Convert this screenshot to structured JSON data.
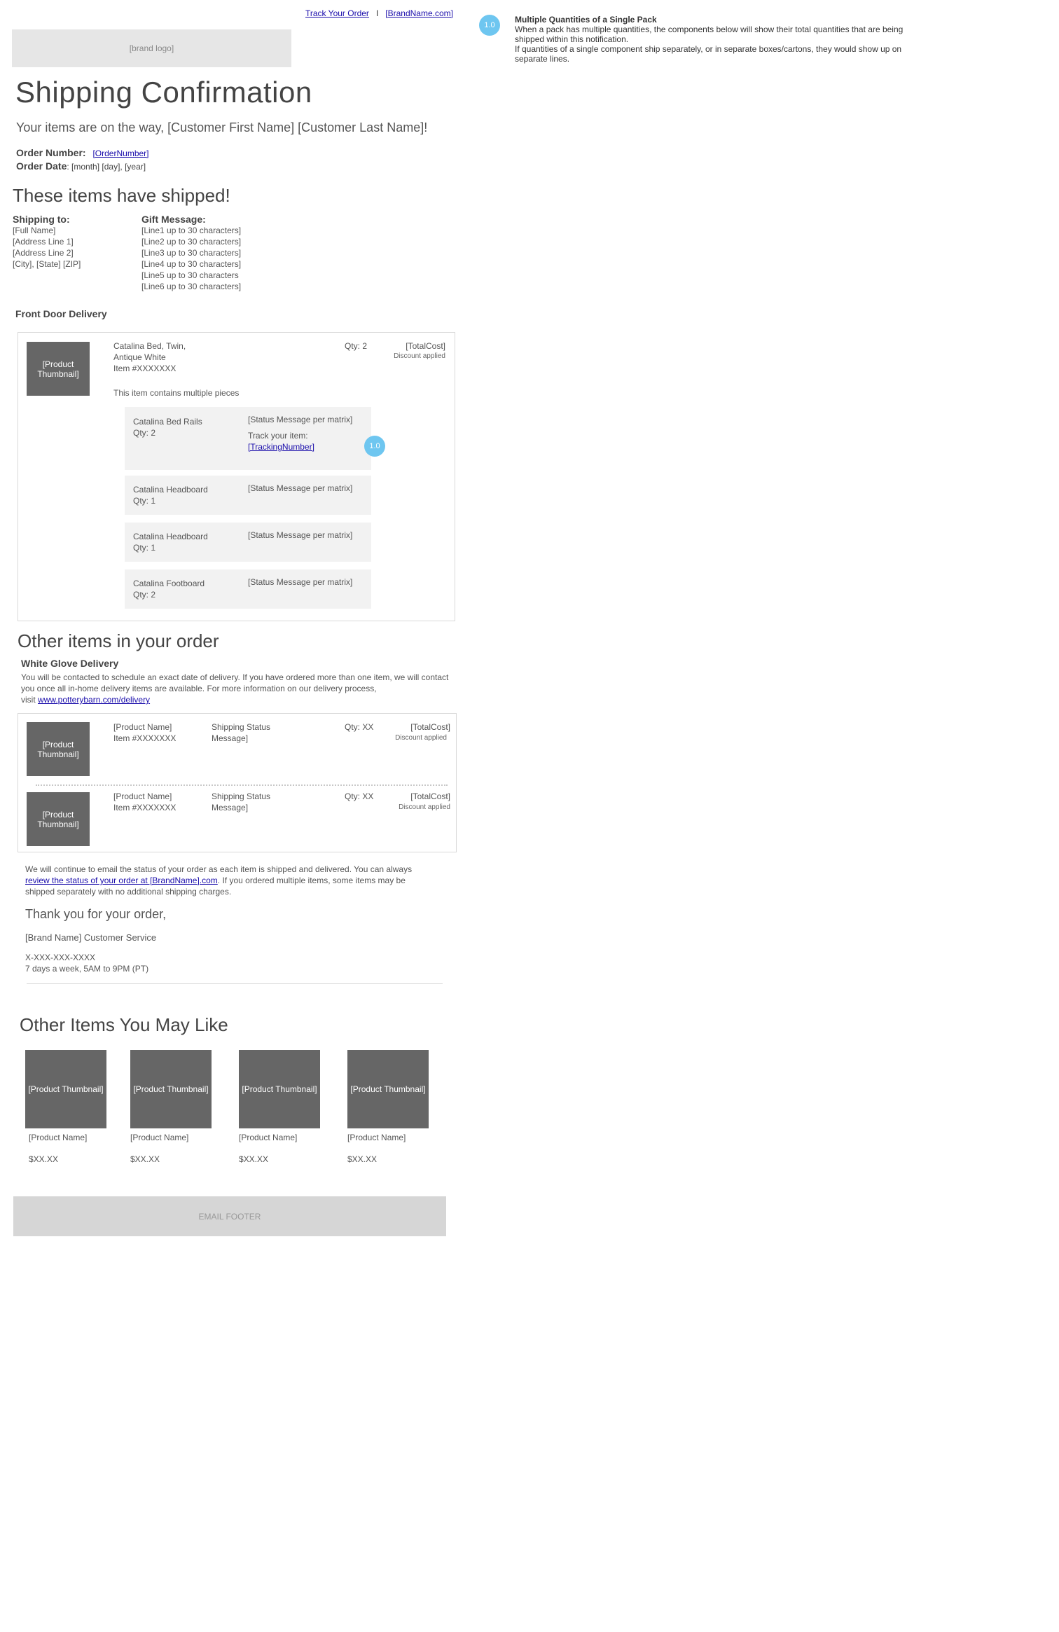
{
  "header": {
    "track_link": "Track Your Order",
    "separator": "I",
    "brand_link": "[BrandName.com]",
    "logo": "[brand logo]"
  },
  "title": "Shipping Confirmation",
  "greeting": "Your items are on the way, [Customer First Name] [Customer Last Name]!",
  "order": {
    "number_label": "Order Number:",
    "number_value": "[OrderNumber]",
    "date_label": "Order Date",
    "date_value": ": [month] [day], [year]"
  },
  "shipped": {
    "heading": "These items have shipped!",
    "shipping_label": "Shipping to:",
    "address": [
      "[Full Name]",
      "[Address Line 1]",
      "[Address Line 2]",
      "[City], [State] [ZIP]"
    ],
    "gift_label": "Gift Message:",
    "gift_lines": [
      "[Line1 up to 30 characters]",
      "[Line2 up to 30 characters]",
      "[Line3 up to 30 characters]",
      "[Line4 up to 30 characters]",
      "[Line5 up to 30 characters",
      "[Line6 up to 30 characters]"
    ],
    "delivery_type": "Front Door Delivery",
    "item": {
      "thumb": "[Product Thumbnail]",
      "name_line1": "Catalina Bed, Twin,",
      "name_line2": "Antique White",
      "sku": "Item #XXXXXXX",
      "qty": "Qty: 2",
      "total": "[TotalCost]",
      "discount": "Discount applied",
      "multi_note": "This item contains multiple pieces"
    },
    "components": [
      {
        "name": "Catalina Bed Rails",
        "qty": "Qty: 2",
        "status": "[Status Message per matrix]",
        "track_label": "Track your item:",
        "tracking": "[TrackingNumber]"
      },
      {
        "name": "Catalina Headboard",
        "qty": "Qty: 1",
        "status": "[Status Message per matrix]"
      },
      {
        "name": "Catalina Headboard",
        "qty": "Qty: 1",
        "status": "[Status Message per matrix]"
      },
      {
        "name": "Catalina Footboard",
        "qty": "Qty: 2",
        "status": "[Status Message per matrix]"
      }
    ],
    "badge": "1.0"
  },
  "other": {
    "heading": "Other items in your order",
    "delivery_type": "White Glove Delivery",
    "desc_line1": "You will be contacted to schedule an exact date of delivery. If you have ordered more than one item, we will contact",
    "desc_line2": "you once all in-home delivery items are available. For more information on our delivery process,",
    "desc_visit": "visit ",
    "desc_link": "www.potterybarn.com/delivery",
    "items": [
      {
        "thumb": "[Product Thumbnail]",
        "name": "[Product Name]",
        "sku": "Item #XXXXXXX",
        "status": "Shipping Status Message]",
        "qty": "Qty: XX",
        "total": "[TotalCost]",
        "discount": "Discount applied"
      },
      {
        "thumb": "[Product Thumbnail]",
        "name": "[Product Name]",
        "sku": "Item #XXXXXXX",
        "status": "Shipping Status Message]",
        "qty": "Qty: XX",
        "total": "[TotalCost]",
        "discount": "Discount applied"
      }
    ]
  },
  "closing": {
    "p1": "We will continue to email the status of your order as each item is shipped and delivered. You can always",
    "p2_link": "review the status of your order at [BrandName].com",
    "p2_rest": ". If you ordered multiple items, some items may be",
    "p3": "shipped separately with no additional shipping charges.",
    "thanks": "Thank you for your order,",
    "signature": "[Brand Name] Customer Service",
    "phone": "X-XXX-XXX-XXXX",
    "hours": "7 days a week, 5AM to 9PM (PT)"
  },
  "recommend": {
    "heading": "Other Items You May Like",
    "items": [
      {
        "thumb": "[Product Thumbnail]",
        "name": "[Product Name]",
        "price": "$XX.XX"
      },
      {
        "thumb": "[Product Thumbnail]",
        "name": "[Product Name]",
        "price": "$XX.XX"
      },
      {
        "thumb": "[Product Thumbnail]",
        "name": "[Product Name]",
        "price": "$XX.XX"
      },
      {
        "thumb": "[Product Thumbnail]",
        "name": "[Product Name]",
        "price": "$XX.XX"
      }
    ]
  },
  "footer": "EMAIL FOOTER",
  "annotation": {
    "badge": "1.0",
    "title": "Multiple Quantities of a Single Pack",
    "body_lines": [
      "When a pack has multiple quantities, the components below will show their total quantities that are being",
      "shipped within this notification.",
      "If quantities of a single component ship separately, or in separate boxes/cartons, they would show up on",
      "separate lines."
    ]
  },
  "colors": {
    "badge": "#6ec6f0",
    "thumbnail": "#666666",
    "component_bg": "#f2f2f2",
    "link": "#1a0dab"
  }
}
